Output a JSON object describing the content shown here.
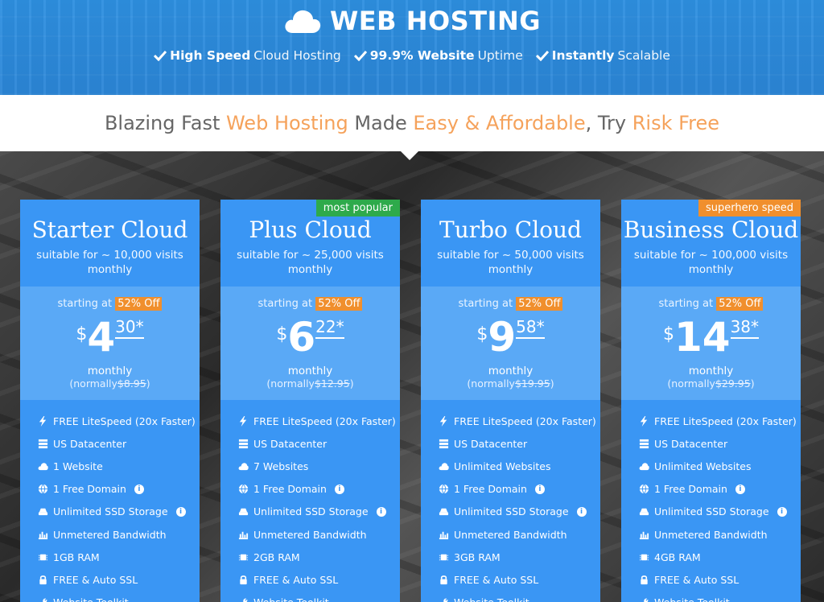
{
  "header": {
    "title": "WEB HOSTING",
    "features": [
      {
        "bold": "High Speed",
        "light": "Cloud Hosting"
      },
      {
        "bold": "99.9% Website",
        "light": "Uptime"
      },
      {
        "bold": "Instantly",
        "light": "Scalable"
      }
    ]
  },
  "tagline": {
    "part1": "Blazing Fast ",
    "hl1": "Web Hosting",
    "part2": " Made ",
    "hl2": "Easy & Affordable",
    "part3": ", Try ",
    "hl3": "Risk Free"
  },
  "colors": {
    "primary": "#3a96f4",
    "price_box": "#5aa9f6",
    "accent_orange": "#f08f2d",
    "badge_green": "#2eaa4b",
    "highlight": "#f5a25b"
  },
  "plans": [
    {
      "name": "Starter Cloud",
      "visits": "suitable for ~ 10,000 visits",
      "period_label": "monthly",
      "badge": "",
      "starting": "starting at",
      "off": "52% Off",
      "currency": "$",
      "price_int": "4",
      "price_cents": "30*",
      "per": "monthly",
      "normally_label": "(normally",
      "normally_price": "$8.95",
      "normally_close": ")",
      "features": [
        {
          "icon": "lightning-icon",
          "text": "FREE LiteSpeed (20x Faster)",
          "info": false
        },
        {
          "icon": "server-icon",
          "text": "US Datacenter",
          "info": false
        },
        {
          "icon": "cloud-icon",
          "text": "1 Website",
          "info": false
        },
        {
          "icon": "globe-icon",
          "text": "1 Free Domain",
          "info": true
        },
        {
          "icon": "drive-icon",
          "text": "Unlimited SSD Storage",
          "info": true
        },
        {
          "icon": "bandwidth-icon",
          "text": "Unmetered Bandwidth",
          "info": false
        },
        {
          "icon": "chip-icon",
          "text": "1GB RAM",
          "info": false
        },
        {
          "icon": "lock-icon",
          "text": "FREE & Auto SSL",
          "info": false
        },
        {
          "icon": "wrench-icon",
          "text": "Website Toolkit",
          "info": false
        }
      ]
    },
    {
      "name": "Plus Cloud",
      "visits": "suitable for ~ 25,000 visits",
      "period_label": "monthly",
      "badge": "most popular",
      "starting": "starting at",
      "off": "52% Off",
      "currency": "$",
      "price_int": "6",
      "price_cents": "22*",
      "per": "monthly",
      "normally_label": "(normally",
      "normally_price": "$12.95",
      "normally_close": ")",
      "features": [
        {
          "icon": "lightning-icon",
          "text": "FREE LiteSpeed (20x Faster)",
          "info": false
        },
        {
          "icon": "server-icon",
          "text": "US Datacenter",
          "info": false
        },
        {
          "icon": "cloud-icon",
          "text": "7 Websites",
          "info": false
        },
        {
          "icon": "globe-icon",
          "text": "1 Free Domain",
          "info": true
        },
        {
          "icon": "drive-icon",
          "text": "Unlimited SSD Storage",
          "info": true
        },
        {
          "icon": "bandwidth-icon",
          "text": "Unmetered Bandwidth",
          "info": false
        },
        {
          "icon": "chip-icon",
          "text": "2GB RAM",
          "info": false
        },
        {
          "icon": "lock-icon",
          "text": "FREE & Auto SSL",
          "info": false
        },
        {
          "icon": "wrench-icon",
          "text": "Website Toolkit",
          "info": false
        }
      ]
    },
    {
      "name": "Turbo Cloud",
      "visits": "suitable for ~ 50,000 visits",
      "period_label": "monthly",
      "badge": "",
      "starting": "starting at",
      "off": "52% Off",
      "currency": "$",
      "price_int": "9",
      "price_cents": "58*",
      "per": "monthly",
      "normally_label": "(normally",
      "normally_price": "$19.95",
      "normally_close": ")",
      "features": [
        {
          "icon": "lightning-icon",
          "text": "FREE LiteSpeed (20x Faster)",
          "info": false
        },
        {
          "icon": "server-icon",
          "text": "US Datacenter",
          "info": false
        },
        {
          "icon": "cloud-icon",
          "text": "Unlimited Websites",
          "info": false
        },
        {
          "icon": "globe-icon",
          "text": "1 Free Domain",
          "info": true
        },
        {
          "icon": "drive-icon",
          "text": "Unlimited SSD Storage",
          "info": true
        },
        {
          "icon": "bandwidth-icon",
          "text": "Unmetered Bandwidth",
          "info": false
        },
        {
          "icon": "chip-icon",
          "text": "3GB RAM",
          "info": false
        },
        {
          "icon": "lock-icon",
          "text": "FREE & Auto SSL",
          "info": false
        },
        {
          "icon": "wrench-icon",
          "text": "Website Toolkit",
          "info": false
        }
      ]
    },
    {
      "name": "Business Cloud",
      "visits": "suitable for ~ 100,000 visits",
      "period_label": "monthly",
      "badge": "superhero speed",
      "starting": "starting at",
      "off": "52% Off",
      "currency": "$",
      "price_int": "14",
      "price_cents": "38*",
      "per": "monthly",
      "normally_label": "(normally",
      "normally_price": "$29.95",
      "normally_close": ")",
      "features": [
        {
          "icon": "lightning-icon",
          "text": "FREE LiteSpeed (20x Faster)",
          "info": false
        },
        {
          "icon": "server-icon",
          "text": "US Datacenter",
          "info": false
        },
        {
          "icon": "cloud-icon",
          "text": "Unlimited Websites",
          "info": false
        },
        {
          "icon": "globe-icon",
          "text": "1 Free Domain",
          "info": true
        },
        {
          "icon": "drive-icon",
          "text": "Unlimited SSD Storage",
          "info": true
        },
        {
          "icon": "bandwidth-icon",
          "text": "Unmetered Bandwidth",
          "info": false
        },
        {
          "icon": "chip-icon",
          "text": "4GB RAM",
          "info": false
        },
        {
          "icon": "lock-icon",
          "text": "FREE & Auto SSL",
          "info": false
        },
        {
          "icon": "wrench-icon",
          "text": "Website Toolkit",
          "info": false
        }
      ]
    }
  ]
}
